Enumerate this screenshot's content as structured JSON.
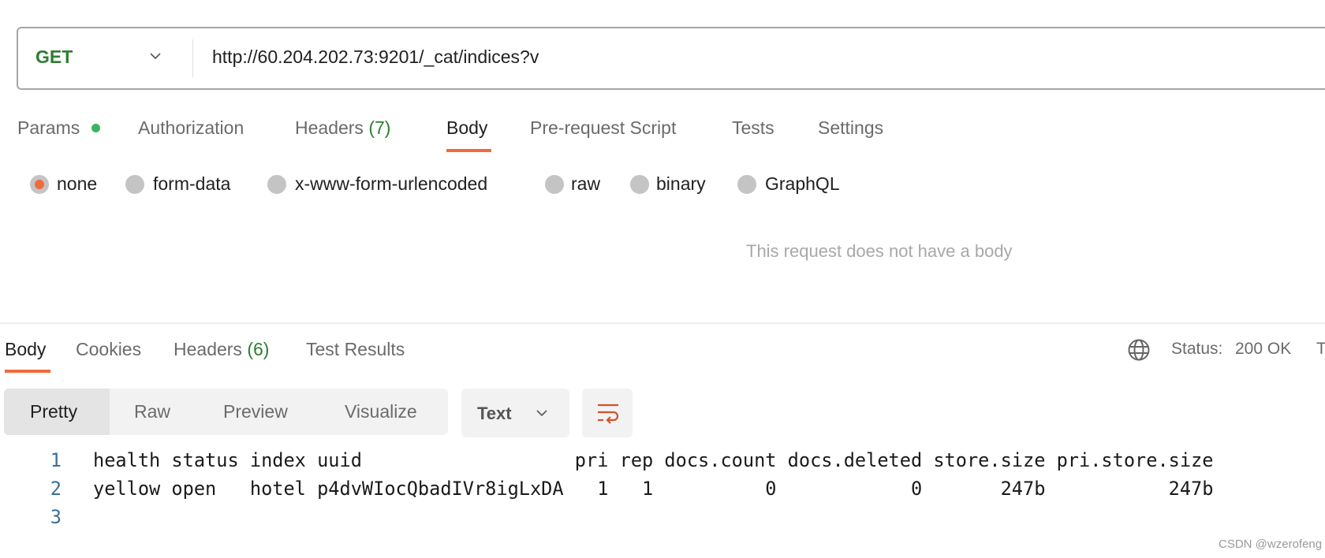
{
  "request": {
    "method": "GET",
    "url": "http://60.204.202.73:9201/_cat/indices?v"
  },
  "request_tabs": [
    {
      "label": "Params",
      "indicator": true
    },
    {
      "label": "Authorization"
    },
    {
      "label": "Headers",
      "count": "(7)"
    },
    {
      "label": "Body",
      "active": true
    },
    {
      "label": "Pre-request Script"
    },
    {
      "label": "Tests"
    },
    {
      "label": "Settings"
    }
  ],
  "body_types": [
    {
      "label": "none",
      "selected": true
    },
    {
      "label": "form-data"
    },
    {
      "label": "x-www-form-urlencoded"
    },
    {
      "label": "raw"
    },
    {
      "label": "binary"
    },
    {
      "label": "GraphQL"
    }
  ],
  "empty_body_message": "This request does not have a body",
  "response_tabs": [
    {
      "label": "Body",
      "active": true
    },
    {
      "label": "Cookies"
    },
    {
      "label": "Headers",
      "count": "(6)"
    },
    {
      "label": "Test Results"
    }
  ],
  "status": {
    "label": "Status:",
    "value": "200 OK",
    "truncated_next": "T"
  },
  "view_modes": [
    {
      "label": "Pretty",
      "active": true
    },
    {
      "label": "Raw"
    },
    {
      "label": "Preview"
    },
    {
      "label": "Visualize"
    }
  ],
  "format_select": "Text",
  "icons": {
    "globe": "globe-icon",
    "wrap": "word-wrap-icon",
    "chevron": "chevron-down-icon"
  },
  "colors": {
    "accent": "#f06b3b",
    "green": "#2f7d32"
  },
  "code_lines": [
    {
      "num": "1",
      "text": "health status index uuid                   pri rep docs.count docs.deleted store.size pri.store.size"
    },
    {
      "num": "2",
      "text": "yellow open   hotel p4dvWIocQbadIVr8igLxDA   1   1          0            0       247b           247b"
    },
    {
      "num": "3",
      "text": ""
    }
  ],
  "watermark": "CSDN @wzerofeng"
}
